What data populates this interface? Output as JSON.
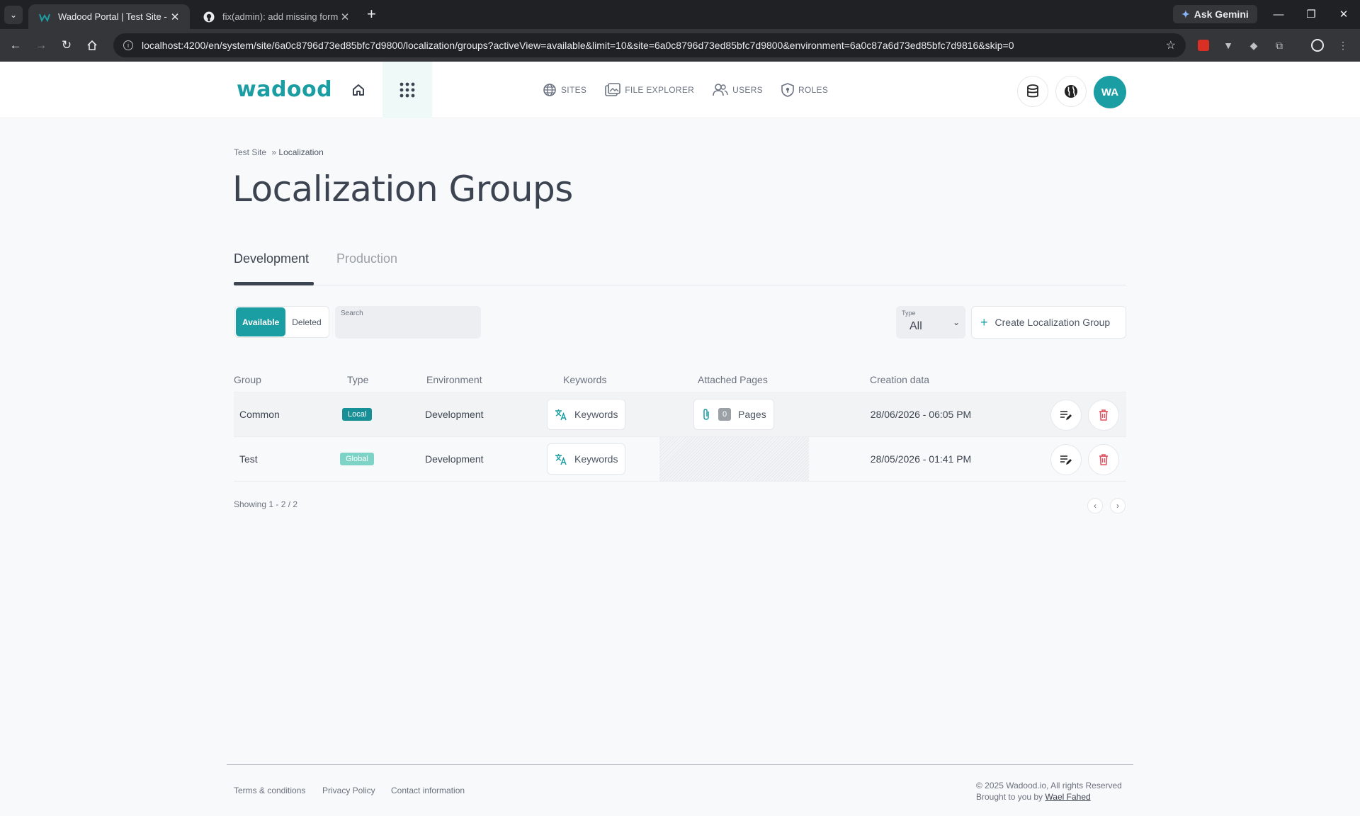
{
  "browser": {
    "tabs": [
      {
        "title": "Wadood Portal | Test Site - Localization",
        "active": true
      },
      {
        "title": "fix(admin): add missing form.validation",
        "active": false
      }
    ],
    "ask_gemini": "Ask Gemini",
    "url": "localhost:4200/en/system/site/6a0c8796d73ed85bfc7d9800/localization/groups?activeView=available&limit=10&site=6a0c8796d73ed85bfc7d9800&environment=6a0c87a6d73ed85bfc7d9816&skip=0"
  },
  "header": {
    "logo": "wadood",
    "nav": [
      {
        "label": "SITES",
        "icon": "globe-icon"
      },
      {
        "label": "FILE EXPLORER",
        "icon": "folder-images-icon"
      },
      {
        "label": "USERS",
        "icon": "users-icon"
      },
      {
        "label": "ROLES",
        "icon": "shield-icon"
      }
    ],
    "avatar_initials": "WA",
    "accent_color": "#1a9ea4"
  },
  "breadcrumb": {
    "site": "Test Site",
    "separator": "»",
    "current": "Localization"
  },
  "page_title": "Localization Groups",
  "env_tabs": [
    {
      "label": "Development",
      "active": true
    },
    {
      "label": "Production",
      "active": false
    }
  ],
  "filters": {
    "view_options": [
      {
        "label": "Available",
        "active": true
      },
      {
        "label": "Deleted",
        "active": false
      }
    ],
    "search": {
      "label": "Search",
      "value": ""
    },
    "type": {
      "label": "Type",
      "value": "All"
    },
    "create_label": "Create Localization Group"
  },
  "table": {
    "columns": [
      "Group",
      "Type",
      "Environment",
      "Keywords",
      "Attached Pages",
      "Creation data"
    ],
    "rows": [
      {
        "group": "Common",
        "type": "Local",
        "environment": "Development",
        "keywords": "Keywords",
        "pages_count": "0",
        "pages_label": "Pages",
        "created": "28/06/2026 - 06:05 PM"
      },
      {
        "group": "Test",
        "type": "Global",
        "environment": "Development",
        "keywords": "Keywords",
        "pages_count": "",
        "pages_label": "",
        "created": "28/05/2026 - 01:41 PM"
      }
    ],
    "showing": "Showing 1 - 2 / 2"
  },
  "footer": {
    "links": [
      "Terms & conditions",
      "Privacy Policy",
      "Contact information"
    ],
    "copyright": "© 2025 Wadood.io, All rights Reserved",
    "brought_by": "Brought to you by",
    "author": "Wael Fahed"
  }
}
